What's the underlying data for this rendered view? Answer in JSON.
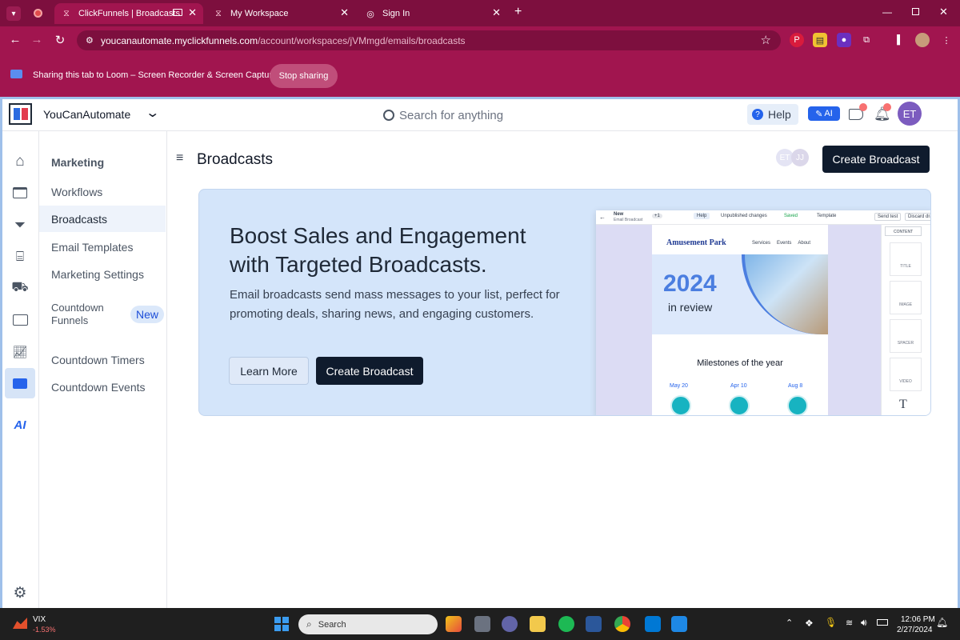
{
  "browser": {
    "tabs": [
      {
        "title": "ClickFunnels | Broadcasts",
        "active": true
      },
      {
        "title": "My Workspace",
        "active": false
      },
      {
        "title": "Sign In",
        "active": false
      }
    ],
    "url_host": "youcanautomate.myclickfunnels.com",
    "url_path": "/account/workspaces/jVMmgd/emails/broadcasts"
  },
  "share_bar": {
    "text": "Sharing this tab to Loom – Screen Recorder & Screen Capture",
    "stop_label": "Stop sharing"
  },
  "topnav": {
    "workspace_name": "YouCanAutomate",
    "search_placeholder": "Search for anything",
    "help_label": "Help",
    "ai_label": "AI",
    "avatar_initials": "ET"
  },
  "sidebar": {
    "section_title": "Marketing",
    "items": [
      {
        "label": "Workflows"
      },
      {
        "label": "Broadcasts"
      },
      {
        "label": "Email Templates"
      },
      {
        "label": "Marketing Settings"
      },
      {
        "label": "Countdown Funnels",
        "badge": "New"
      },
      {
        "label": "Countdown Timers"
      },
      {
        "label": "Countdown Events"
      }
    ]
  },
  "page": {
    "title": "Broadcasts",
    "create_label": "Create Broadcast",
    "presence": [
      "ET",
      "JJ"
    ]
  },
  "hero": {
    "heading": "Boost Sales and Engagement with Targeted Broadcasts.",
    "body": "Email broadcasts send mass messages to your list, perfect for promoting deals, sharing news, and engaging customers.",
    "learn_more": "Learn More",
    "create_label": "Create Broadcast"
  },
  "preview": {
    "doc_title": "New",
    "doc_subtitle": "Email Broadcast",
    "count": "+1",
    "help": "Help",
    "unpublished": "Unpublished changes",
    "saved": "Saved",
    "template": "Template",
    "send_test": "Send test",
    "discard": "Discard draft",
    "content_tab": "CONTENT",
    "logo": "Amusement Park",
    "nav": [
      "Services",
      "Events",
      "About"
    ],
    "year": "2024",
    "in_review": "in review",
    "milestones_title": "Milestones of the year",
    "milestones": [
      "May 20",
      "Apr 10",
      "Aug 8"
    ],
    "blocks": [
      "TITLE",
      "IMAGE",
      "SPACER",
      "VIDEO"
    ]
  },
  "taskbar": {
    "ticker_name": "VIX",
    "ticker_change": "-1.53%",
    "search_placeholder": "Search",
    "time": "12:06 PM",
    "date": "2/27/2024"
  }
}
